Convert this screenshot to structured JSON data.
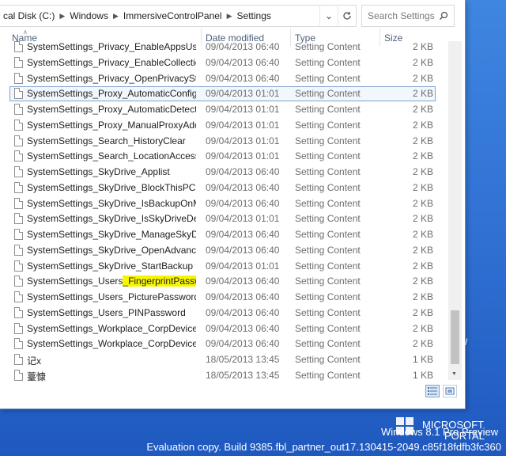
{
  "address": {
    "crumbs": [
      "cal Disk (C:)",
      "Windows",
      "ImmersiveControlPanel",
      "Settings"
    ],
    "dropdown_icon": "chevron-down-icon",
    "refresh_icon": "refresh-icon"
  },
  "search": {
    "placeholder": "Search Settings",
    "icon": "search-icon"
  },
  "columns": {
    "name": "Name",
    "date": "Date modified",
    "type": "Type",
    "size": "Size"
  },
  "files": [
    {
      "name": "SystemSettings_Privacy_EnableAppsUse...",
      "date": "09/04/2013 06:40",
      "type": "Setting Content",
      "size": "2 KB"
    },
    {
      "name": "SystemSettings_Privacy_EnableCollection...",
      "date": "09/04/2013 06:40",
      "type": "Setting Content",
      "size": "2 KB"
    },
    {
      "name": "SystemSettings_Privacy_OpenPrivacyStat...",
      "date": "09/04/2013 06:40",
      "type": "Setting Content",
      "size": "2 KB"
    },
    {
      "name": "SystemSettings_Proxy_AutomaticConfigS...",
      "date": "09/04/2013 01:01",
      "type": "Setting Content",
      "size": "2 KB",
      "selected": true
    },
    {
      "name": "SystemSettings_Proxy_AutomaticDetection",
      "date": "09/04/2013 01:01",
      "type": "Setting Content",
      "size": "2 KB"
    },
    {
      "name": "SystemSettings_Proxy_ManualProxyAddr...",
      "date": "09/04/2013 01:01",
      "type": "Setting Content",
      "size": "2 KB"
    },
    {
      "name": "SystemSettings_Search_HistoryClear",
      "date": "09/04/2013 01:01",
      "type": "Setting Content",
      "size": "2 KB"
    },
    {
      "name": "SystemSettings_Search_LocationAccess",
      "date": "09/04/2013 01:01",
      "type": "Setting Content",
      "size": "2 KB"
    },
    {
      "name": "SystemSettings_SkyDrive_Applist",
      "date": "09/04/2013 06:40",
      "type": "Setting Content",
      "size": "2 KB"
    },
    {
      "name": "SystemSettings_SkyDrive_BlockThisPCBa...",
      "date": "09/04/2013 06:40",
      "type": "Setting Content",
      "size": "2 KB"
    },
    {
      "name": "SystemSettings_SkyDrive_IsBackupOnMe...",
      "date": "09/04/2013 06:40",
      "type": "Setting Content",
      "size": "2 KB"
    },
    {
      "name": "SystemSettings_SkyDrive_IsSkyDriveDefa...",
      "date": "09/04/2013 01:01",
      "type": "Setting Content",
      "size": "2 KB"
    },
    {
      "name": "SystemSettings_SkyDrive_ManageSkyDriv...",
      "date": "09/04/2013 06:40",
      "type": "Setting Content",
      "size": "2 KB"
    },
    {
      "name": "SystemSettings_SkyDrive_OpenAdvanced...",
      "date": "09/04/2013 06:40",
      "type": "Setting Content",
      "size": "2 KB"
    },
    {
      "name": "SystemSettings_SkyDrive_StartBackup",
      "date": "09/04/2013 01:01",
      "type": "Setting Content",
      "size": "2 KB"
    },
    {
      "name_prefix": "SystemSettings_Users",
      "name_highlight": "_FingerprintPassword",
      "date": "09/04/2013 06:40",
      "type": "Setting Content",
      "size": "2 KB"
    },
    {
      "name": "SystemSettings_Users_PicturePassword",
      "date": "09/04/2013 06:40",
      "type": "Setting Content",
      "size": "2 KB"
    },
    {
      "name": "SystemSettings_Users_PINPassword",
      "date": "09/04/2013 06:40",
      "type": "Setting Content",
      "size": "2 KB"
    },
    {
      "name": "SystemSettings_Workplace_CorpDevice...",
      "date": "09/04/2013 06:40",
      "type": "Setting Content",
      "size": "2 KB"
    },
    {
      "name": "SystemSettings_Workplace_CorpDeviceR...",
      "date": "09/04/2013 06:40",
      "type": "Setting Content",
      "size": "2 KB"
    },
    {
      "name": "记x",
      "date": "18/05/2013 13:45",
      "type": "Setting Content",
      "size": "1 KB"
    },
    {
      "name": "薹慷",
      "date": "18/05/2013 13:45",
      "type": "Setting Content",
      "size": "1 KB"
    }
  ],
  "highlight_color": "#f7f600",
  "selection_border_color": "#7da2ce",
  "view_buttons": [
    "details-view-icon",
    "large-icons-view-icon"
  ],
  "watermark": {
    "preview": "Windows 8.1 Pro Preview",
    "evaluation": "Evaluation copy. Build 9385.fbl_partner_out17.130415-2049.c85f18fdfb3fc360",
    "brand_line1": "MICROSOFT",
    "brand_line2": "PORTAL",
    "brand_logo": "windows-logo-icon",
    "edge_glyph": "/"
  }
}
